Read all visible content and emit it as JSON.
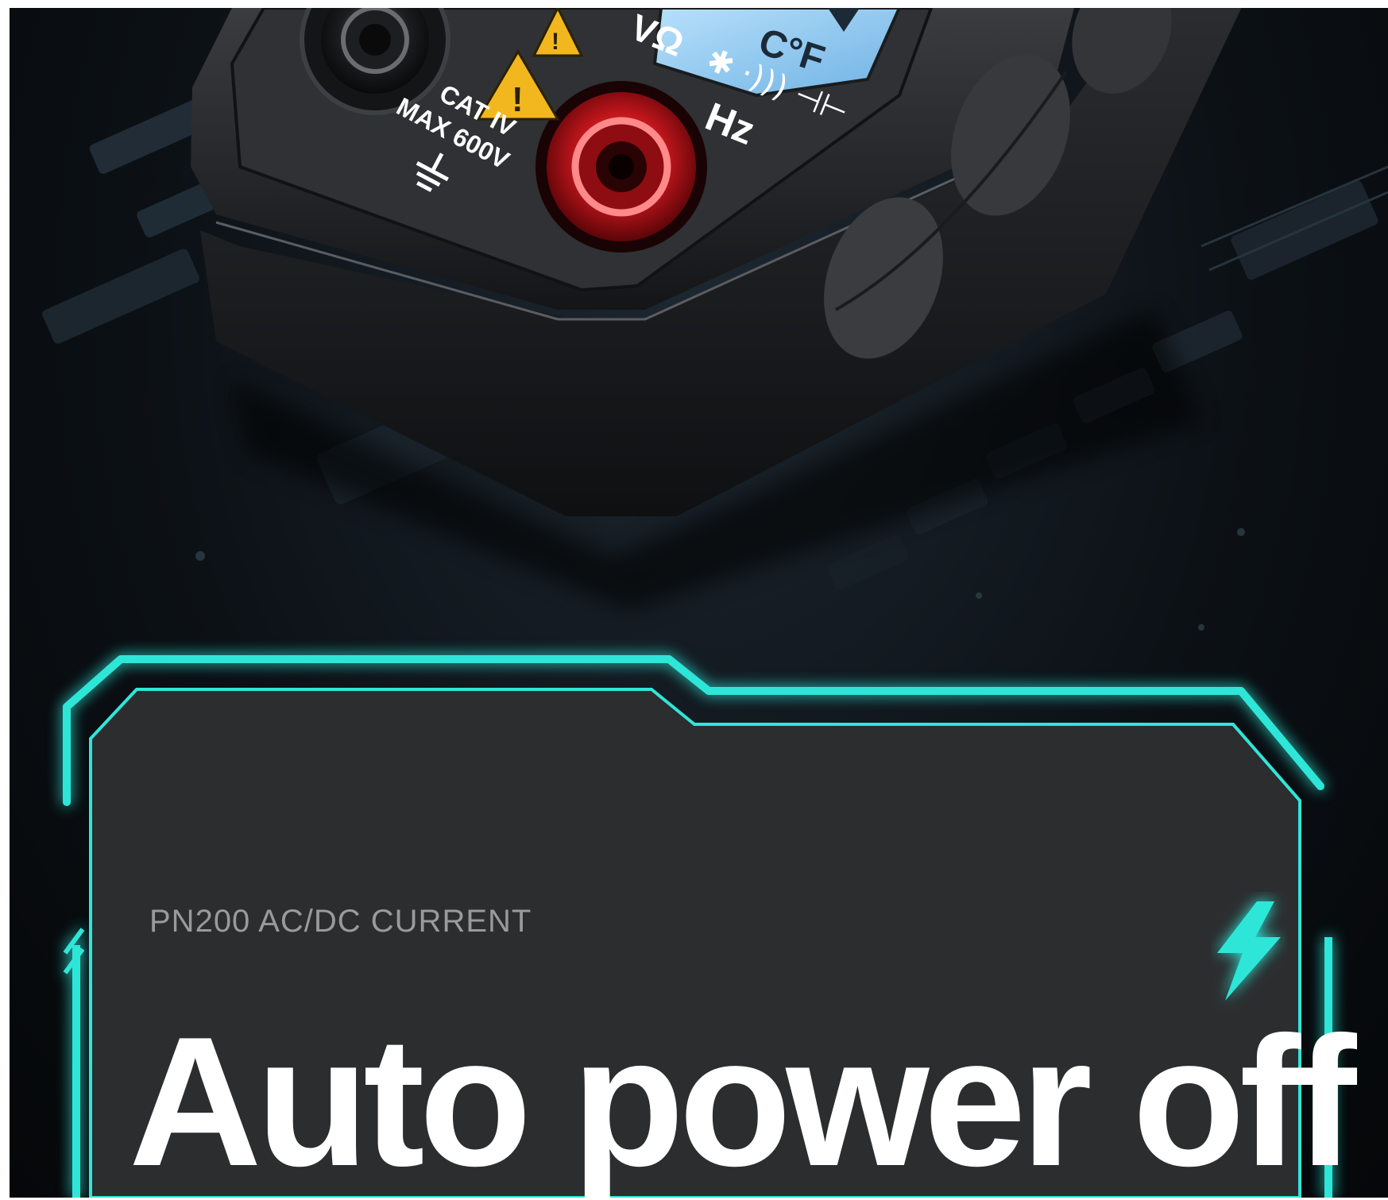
{
  "meter": {
    "display_units": "C°F",
    "left_port_ratings": [
      "CAT IV",
      "MAX 600V"
    ],
    "right_port_functions": [
      "VΩ",
      "Hz"
    ]
  },
  "card": {
    "subtitle": "PN200 AC/DC CURRENT",
    "heading": "Auto power off"
  },
  "icons": {
    "feature_icon": "lightning-bolt-icon",
    "warning_icon": "warning-triangle-icon",
    "ground_icon": "ground-symbol-icon"
  },
  "colors": {
    "accent": "#2fe6d8",
    "card_background": "#2c2d2f",
    "background": "#0c1116",
    "meter_body": "#26282b",
    "probe_port_red": "#c2161c",
    "warning_yellow": "#f2b71f",
    "lcd_blue": "#8ec7ee"
  }
}
